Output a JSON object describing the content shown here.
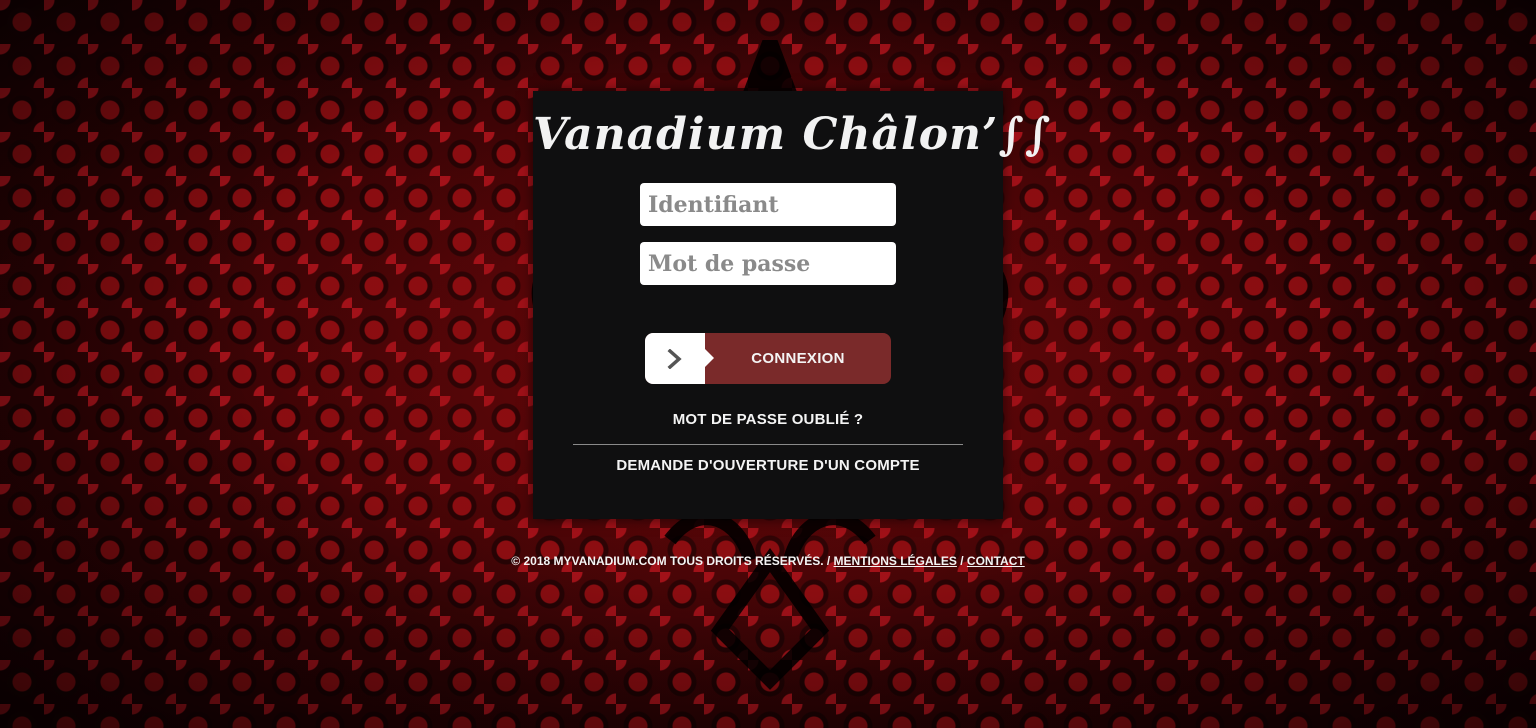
{
  "brand": {
    "title": "Vanadium Châlon’∫∫"
  },
  "login": {
    "username_placeholder": "Identifiant",
    "username_value": "",
    "password_placeholder": "Mot de passe",
    "password_value": "",
    "submit_label": "Connexion"
  },
  "links": {
    "forgot_password": "Mot de passe oublié ?",
    "request_account": "Demande d'ouverture d'un compte"
  },
  "footer": {
    "copyright": "© 2018 myvanadium.com Tous droits réservés. /",
    "legal_label": "Mentions légales",
    "separator": "/",
    "contact_label": "Contact"
  },
  "theme": {
    "background_color": "#5a0608",
    "panel_color": "#0f0f10",
    "button_color": "#7a2a2a",
    "text_color": "#f4f4f4"
  }
}
